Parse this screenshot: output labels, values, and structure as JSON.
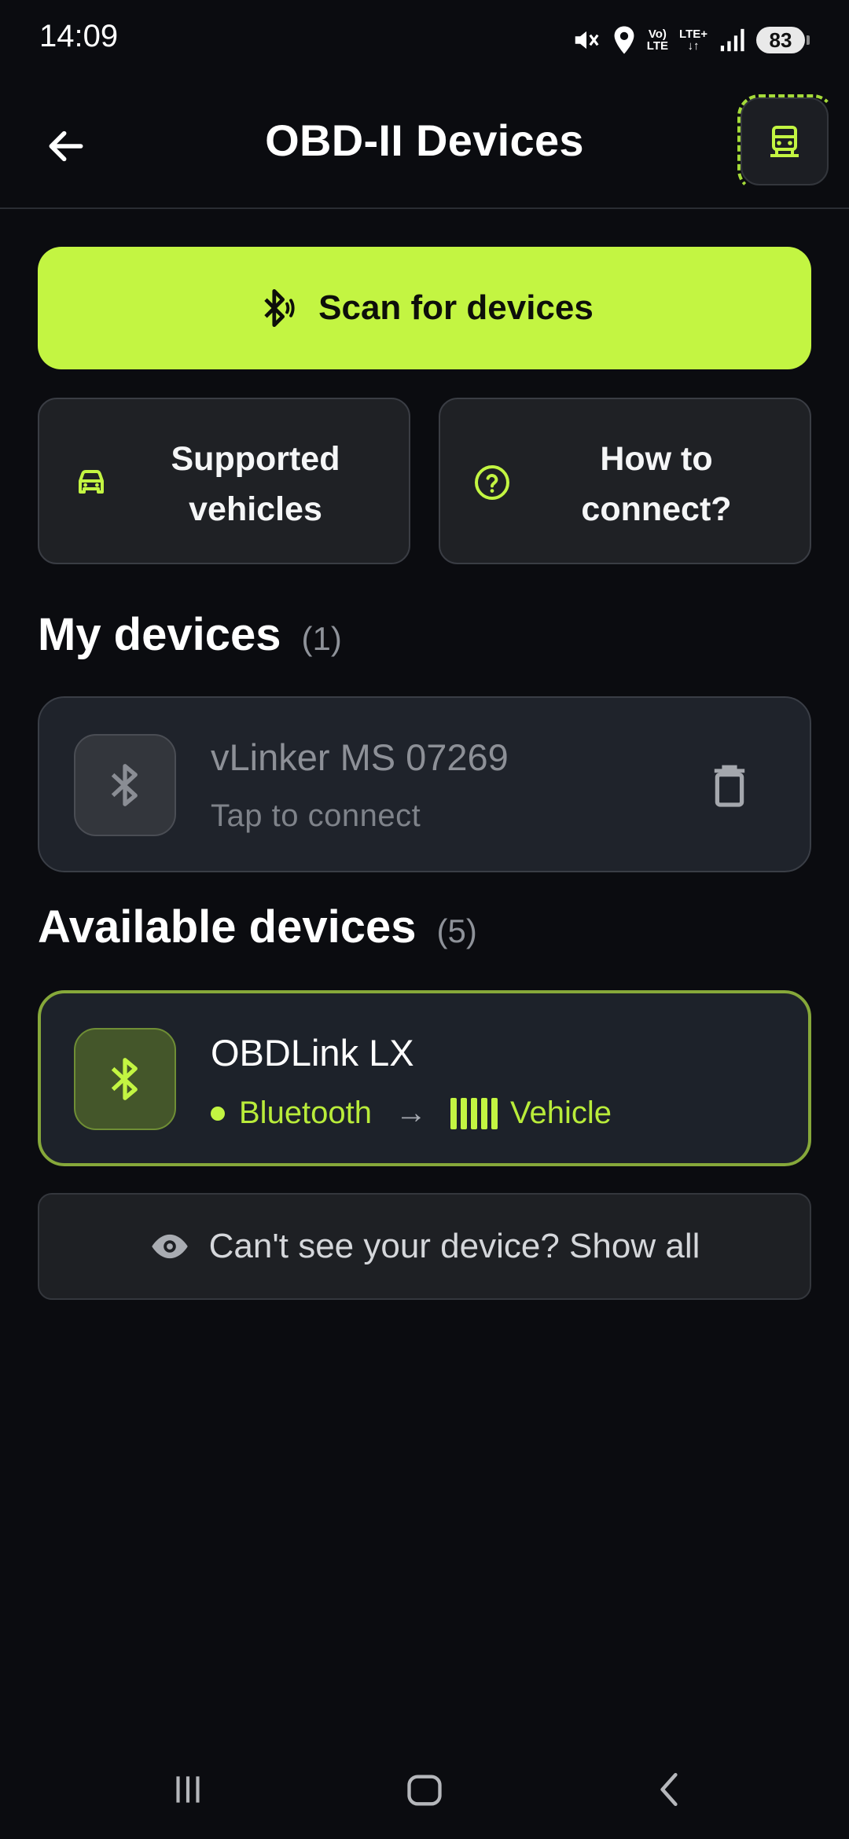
{
  "status_bar": {
    "time": "14:09",
    "volte": "Vo)\nLTE",
    "lte": "LTE+",
    "battery": "83",
    "icons": [
      "mute-icon",
      "location-icon",
      "volte-icon",
      "lte-icon",
      "signal-icon",
      "battery-icon"
    ]
  },
  "app_bar": {
    "title": "OBD-II Devices",
    "back_icon": "arrow-left-icon",
    "action_icon": "car-icon"
  },
  "scan": {
    "label": "Scan for devices",
    "icon": "bluetooth-searching-icon"
  },
  "quick_actions": [
    {
      "label": "Supported\nvehicles",
      "icon": "car-icon"
    },
    {
      "label": "How to\nconnect?",
      "icon": "help-circle-icon"
    }
  ],
  "my_devices": {
    "heading": "My devices",
    "count": "(1)",
    "items": [
      {
        "name": "vLinker MS 07269",
        "status": "Tap to connect",
        "icon": "bluetooth-icon"
      }
    ]
  },
  "available_devices": {
    "heading": "Available devices",
    "count": "(5)",
    "items": [
      {
        "name": "OBDLink LX",
        "connection": "Bluetooth",
        "arrow": "→",
        "target": "Vehicle",
        "icon": "bluetooth-icon"
      }
    ]
  },
  "show_all": {
    "label": "Can't see your device? Show all",
    "icon": "eye-icon"
  },
  "colors": {
    "background": "#0b0c10",
    "accent": "#c3f542",
    "card": "#1f232b",
    "muted_text": "#8d9097"
  },
  "nav": {
    "icons": [
      "recents-icon",
      "home-icon",
      "back-icon"
    ]
  }
}
